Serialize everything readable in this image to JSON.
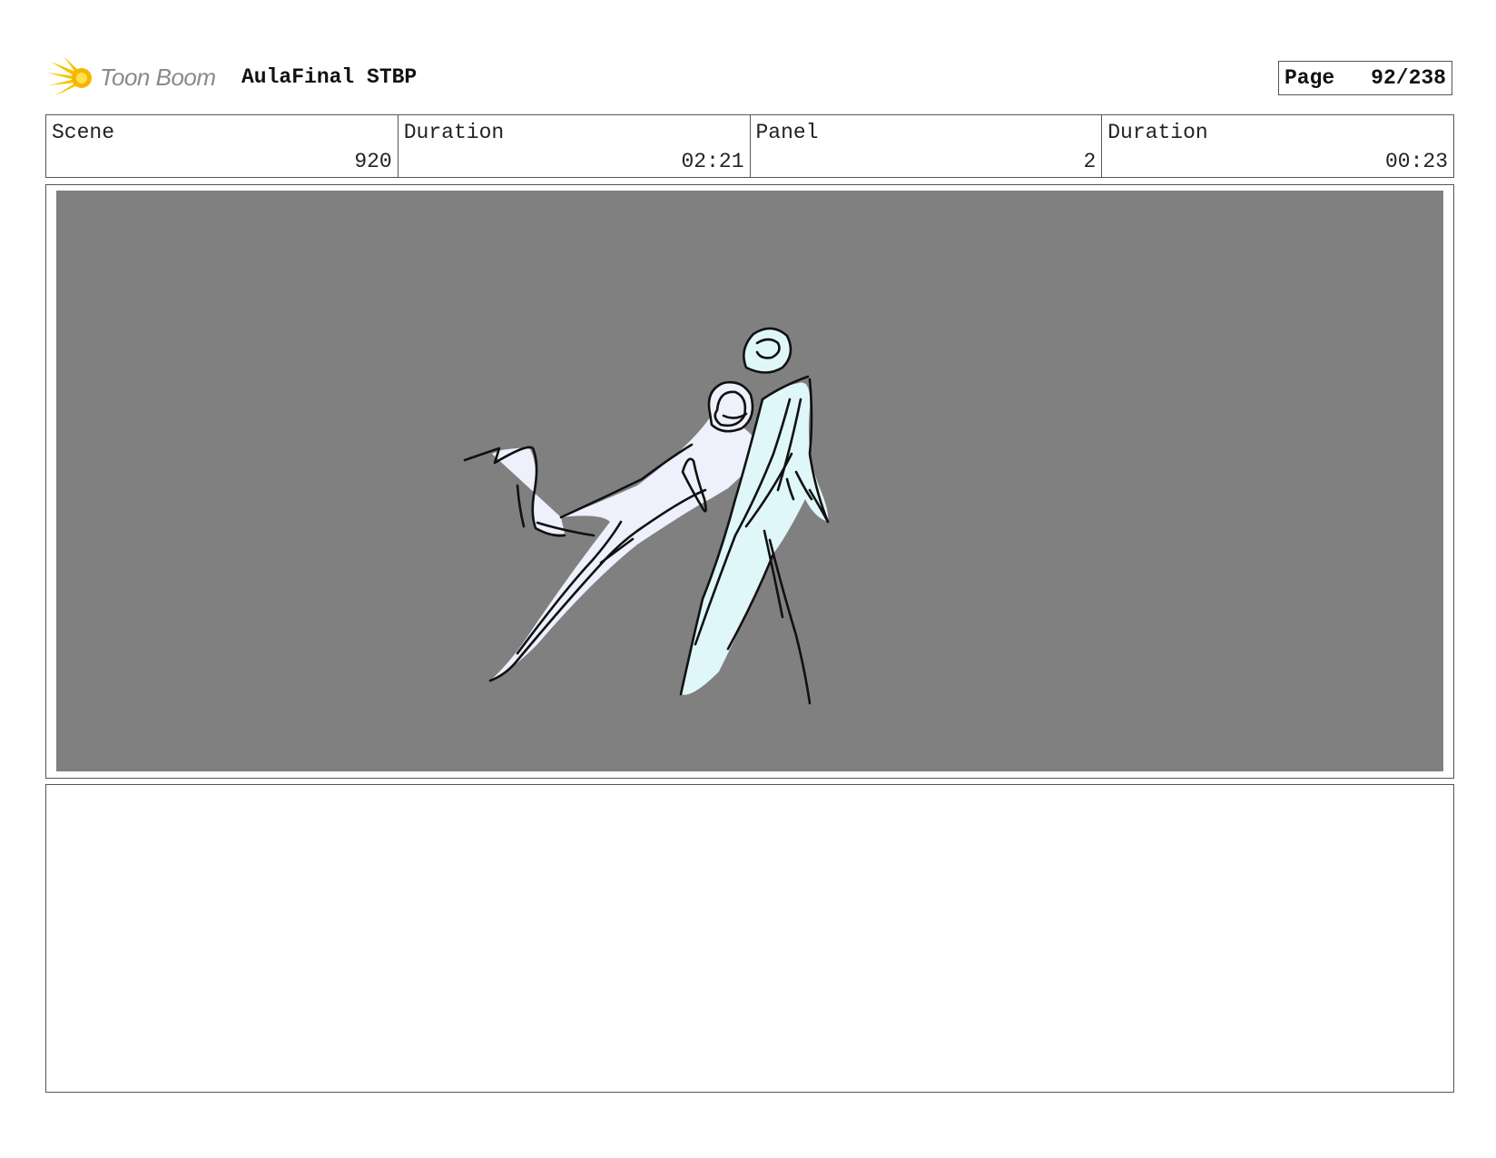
{
  "header": {
    "logo_text": "Toon Boom",
    "project_title": "AulaFinal STBP"
  },
  "page": {
    "label": "Page",
    "value": "92/238"
  },
  "info": {
    "scene_label": "Scene",
    "scene_value": "920",
    "scene_duration_label": "Duration",
    "scene_duration_value": "02:21",
    "panel_label": "Panel",
    "panel_value": "2",
    "panel_duration_label": "Duration",
    "panel_duration_value": "00:23"
  },
  "colors": {
    "panel_background": "#808080",
    "figure_left_fill": "#eef0fb",
    "figure_right_fill": "#e0f7f9",
    "logo_accent": "#f5c400"
  },
  "icons": {
    "logo": "toon-boom-star-icon"
  }
}
